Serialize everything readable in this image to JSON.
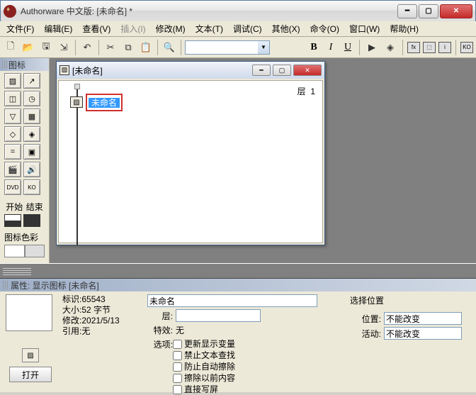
{
  "titlebar": {
    "title": "Authorware 中文版: [未命名] *"
  },
  "menu": {
    "file": "文件(F)",
    "edit": "编辑(E)",
    "view": "查看(V)",
    "insert": "插入(I)",
    "modify": "修改(M)",
    "text": "文本(T)",
    "debug": "调试(C)",
    "other": "其他(X)",
    "command": "命令(O)",
    "window": "窗口(W)",
    "help": "帮助(H)"
  },
  "palette": {
    "title": "图标",
    "start_label": "开始",
    "end_label": "结束",
    "color_label": "图标色彩"
  },
  "doc": {
    "title": "[未命名]",
    "node_label": "未命名",
    "layer_label": "层",
    "layer_value": "1"
  },
  "props": {
    "title": "属性: 显示图标 [未命名]",
    "meta": {
      "id_label": "标识:",
      "id_value": "65543",
      "size_label": "大小:",
      "size_value": "52 字节",
      "modified_label": "修改:",
      "modified_value": "2021/5/13",
      "ref_label": "引用:",
      "ref_value": "无"
    },
    "open_label": "打开",
    "name_value": "未命名",
    "layer_label": "层:",
    "layer_value": "",
    "effect_label": "特效:",
    "effect_value": "无",
    "options_label": "选项:",
    "options": {
      "o1": "更新显示变量",
      "o2": "禁止文本查找",
      "o3": "防止自动擦除",
      "o4": "擦除以前内容",
      "o5": "直接写屏"
    },
    "position_header": "选择位置",
    "position_label": "位置:",
    "position_value": "不能改变",
    "activity_label": "活动:",
    "activity_value": "不能改变"
  }
}
